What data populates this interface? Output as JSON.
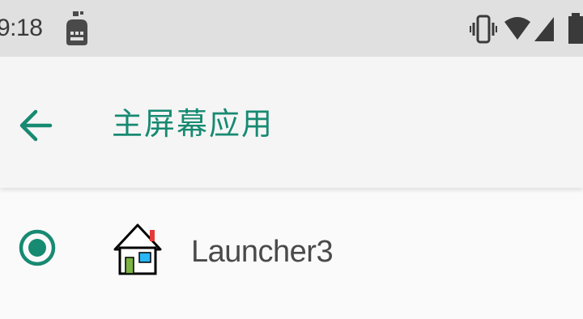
{
  "status_bar": {
    "time": "9:18",
    "icons": [
      "notification-app-icon",
      "vibrate-icon",
      "wifi-icon",
      "signal-icon",
      "battery-icon"
    ]
  },
  "app_bar": {
    "back_icon": "arrow-back-icon",
    "title": "主屏幕应用"
  },
  "options": [
    {
      "label": "Launcher3",
      "icon": "launcher3-house-icon",
      "selected": true
    }
  ],
  "colors": {
    "accent": "#178a72",
    "status_bar_bg": "#e0e0e0",
    "app_bar_bg": "#f5f5f5",
    "background": "#fafafa"
  }
}
